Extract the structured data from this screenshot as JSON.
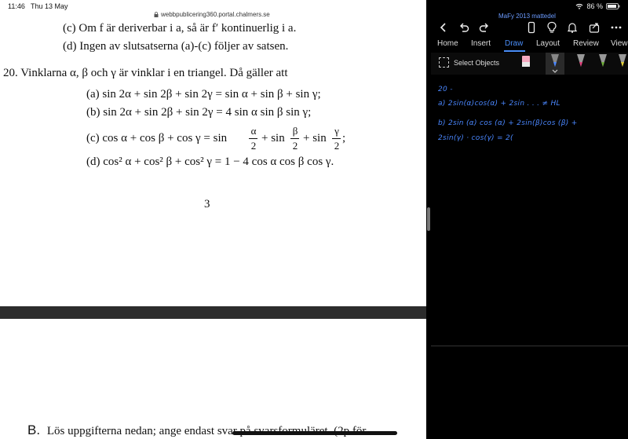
{
  "status_left": {
    "time": "11:46",
    "date": "Thu 13 May"
  },
  "browser": {
    "url": "webbpublicering360.portal.chalmers.se"
  },
  "pdf": {
    "line_c": "(c) Om f är deriverbar i a, så är f′ kontinuerlig i a.",
    "line_d": "(d) Ingen av slutsatserna (a)-(c) följer av satsen.",
    "q20_head": "20. Vinklarna α, β och γ är vinklar i en triangel. Då gäller att",
    "opt_a": "(a)  sin 2α + sin 2β + sin 2γ = sin α + sin β + sin γ;",
    "opt_b": "(b)  sin 2α + sin 2β + sin 2γ = 4 sin α sin β sin γ;",
    "opt_c_label": "(c)  cos α + cos β + cos γ = sin",
    "opt_c_alpha": "α",
    "opt_c_beta": "β",
    "opt_c_gamma": "γ",
    "opt_c_den": "2",
    "opt_c_plus": "+ sin",
    "opt_c_end": ";",
    "opt_d": "(d)  cos² α + cos² β + cos² γ = 1 − 4 cos α cos β cos γ.",
    "page_number": "3",
    "footer_letter": "B.",
    "footer_text": "Lös uppgifterna nedan; ange endast svar på svarsformuläret. (2p för"
  },
  "status_right": {
    "battery": "86 %"
  },
  "onenote": {
    "notebook_title": "MaFy 2013 mattedel",
    "tabs": [
      "Home",
      "Insert",
      "Draw",
      "Layout",
      "Review",
      "View"
    ],
    "select_objects": "Select Objects",
    "ink_lines": [
      "20 -",
      "a) 2sin(α)cos(α) + 2sin . . .  ≠  HL",
      "b)  2sin (α) cos (α)  +  2sin(β)cos (β) +",
      "2sin(γ) · cos(γ) = 2("
    ]
  },
  "colors": {
    "accent": "#4a8df7",
    "ink": "#4a87ff",
    "pen_pink": "#e0407a",
    "pen_green": "#6fae3a"
  }
}
